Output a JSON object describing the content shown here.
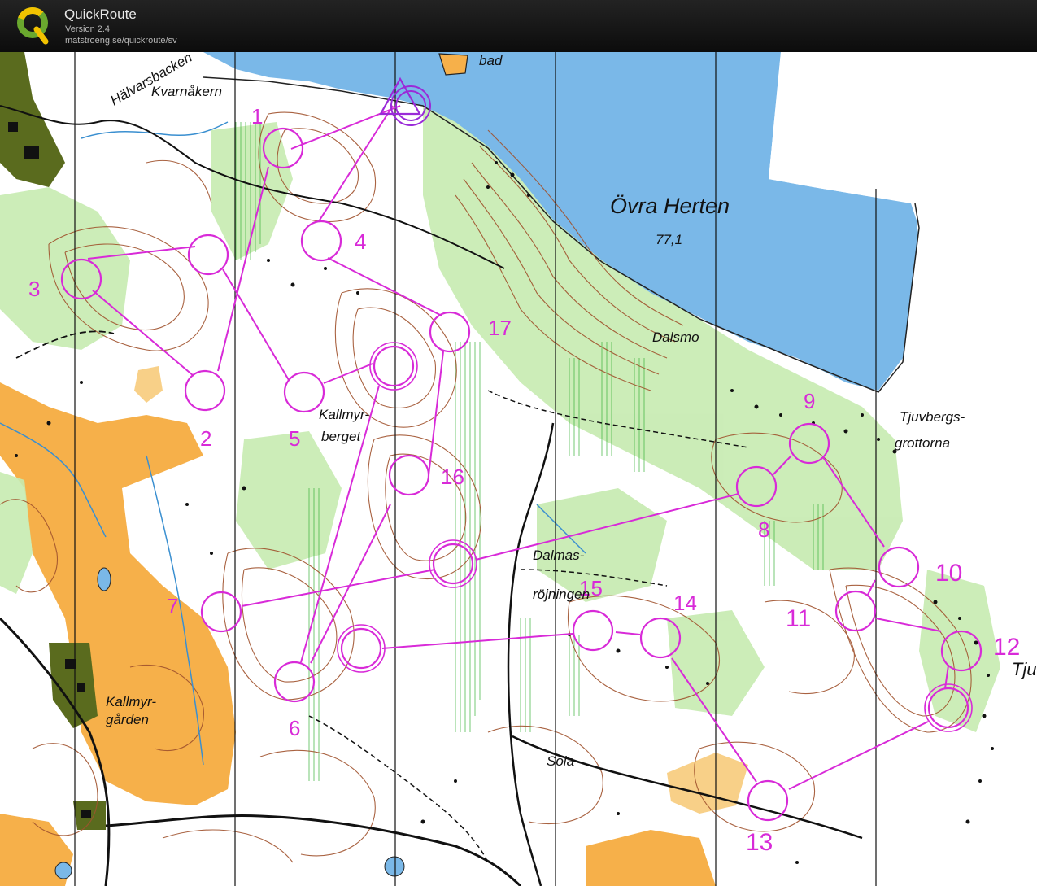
{
  "app": {
    "title": "QuickRoute",
    "version": "Version 2.4",
    "url": "matstroeng.se/quickroute/sv"
  },
  "colors": {
    "course": "#d82ad8",
    "water": "#7ab8e8",
    "open_land": "#f6b04a",
    "forest_green": "#b8e4a0",
    "contour": "#a0522d",
    "header_bg": "#151515"
  },
  "map": {
    "lake_name": "Övra Herten",
    "lake_altitude": "77,1",
    "place_names": [
      "Hälvarsbacken",
      "Kvarnåkern",
      "bad",
      "Dalsmo",
      "Tjuvbergs-",
      "grottorna",
      "Kallmyr-",
      "berget",
      "Dalmas-",
      "röjningen",
      "Kallmyr-",
      "gården",
      "Sola",
      "Tju"
    ]
  },
  "course": {
    "controls": [
      "1",
      "2",
      "3",
      "4",
      "5",
      "6",
      "7",
      "8",
      "9",
      "10",
      "11",
      "12",
      "13",
      "14",
      "15",
      "16",
      "17"
    ]
  }
}
